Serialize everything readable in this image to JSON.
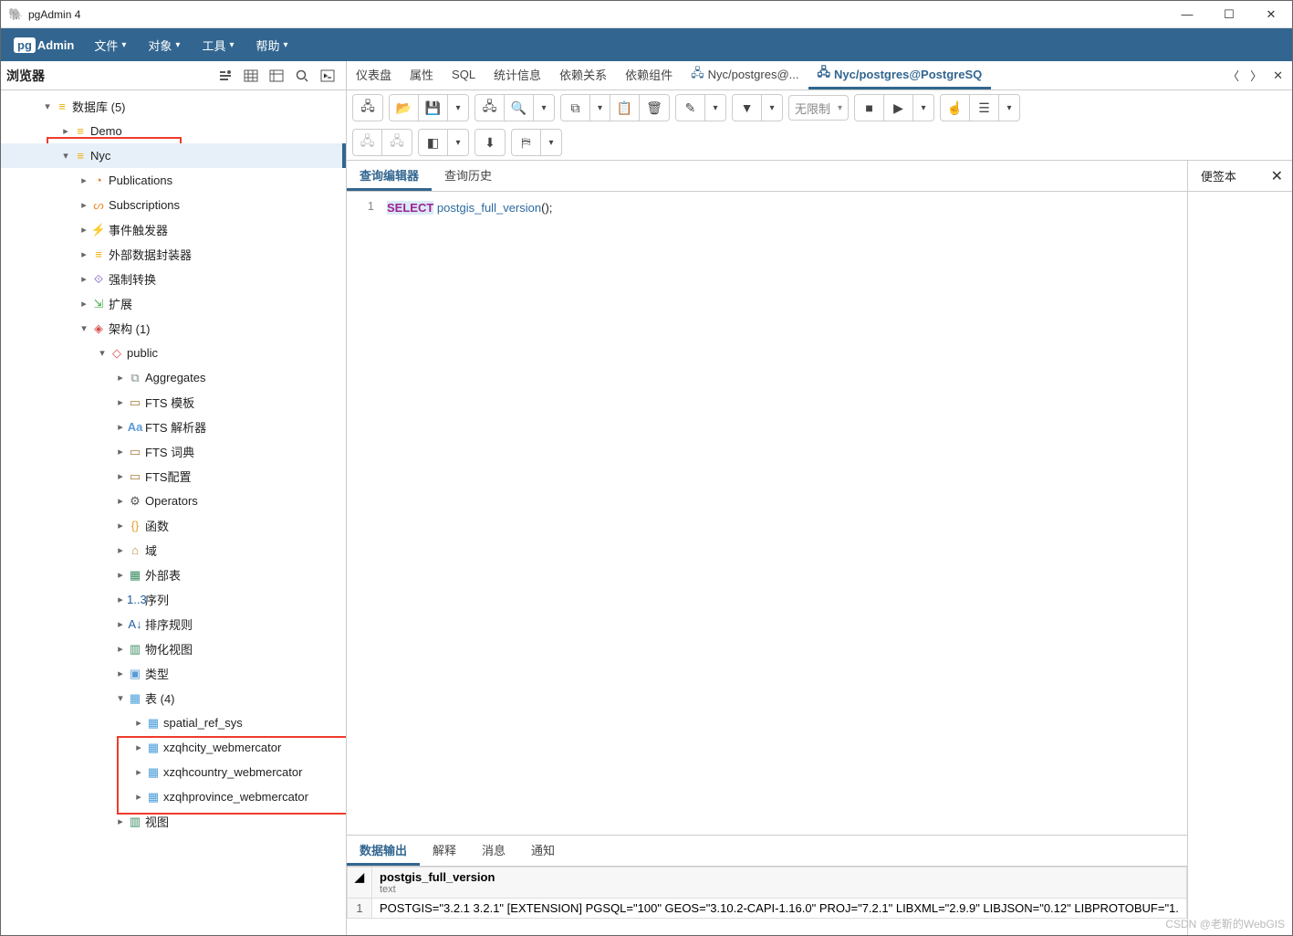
{
  "window": {
    "title": "pgAdmin 4"
  },
  "menubar": {
    "logo_pg": "pg",
    "logo_admin": "Admin",
    "items": [
      "文件",
      "对象",
      "工具",
      "帮助"
    ]
  },
  "sidebar": {
    "title": "浏览器",
    "tree": {
      "databases_label": "数据库 (5)",
      "db_demo": "Demo",
      "db_nyc": "Nyc",
      "nyc_children": {
        "publications": "Publications",
        "subscriptions": "Subscriptions",
        "event_triggers": "事件触发器",
        "foreign_wrappers": "外部数据封装器",
        "casts": "强制转换",
        "extensions": "扩展",
        "schemas": "架构 (1)",
        "public": "public",
        "public_children": {
          "aggregates": "Aggregates",
          "fts_templates": "FTS 模板",
          "fts_parsers": "FTS 解析器",
          "fts_dictionaries": "FTS 词典",
          "fts_config": "FTS配置",
          "operators": "Operators",
          "functions": "函数",
          "domains": "域",
          "foreign_tables": "外部表",
          "sequences": "序列",
          "collations": "排序规则",
          "mat_views": "物化视图",
          "types": "类型",
          "tables": "表 (4)",
          "table_items": [
            "spatial_ref_sys",
            "xzqhcity_webmercator",
            "xzqhcountry_webmercator",
            "xzqhprovince_webmercator"
          ],
          "views": "视图"
        }
      }
    }
  },
  "main_tabs": {
    "items": [
      "仪表盘",
      "属性",
      "SQL",
      "统计信息",
      "依赖关系",
      "依赖组件"
    ],
    "conn1": "Nyc/postgres@...",
    "conn2": "Nyc/postgres@PostgreSQ"
  },
  "toolbar": {
    "limit": "无限制"
  },
  "editor_tabs": {
    "editor": "查询编辑器",
    "history": "查询历史"
  },
  "notes": {
    "title": "便签本"
  },
  "sql": {
    "line": "1",
    "select": "SELECT",
    "func": "postgis_full_version",
    "paren": "();"
  },
  "results": {
    "tabs": [
      "数据输出",
      "解释",
      "消息",
      "通知"
    ],
    "header": "postgis_full_version",
    "header_type": "text",
    "row_idx": "1",
    "row_val": "POSTGIS=\"3.2.1 3.2.1\" [EXTENSION] PGSQL=\"100\" GEOS=\"3.10.2-CAPI-1.16.0\" PROJ=\"7.2.1\" LIBXML=\"2.9.9\" LIBJSON=\"0.12\" LIBPROTOBUF=\"1."
  },
  "watermark": "CSDN @老靳的WebGIS"
}
